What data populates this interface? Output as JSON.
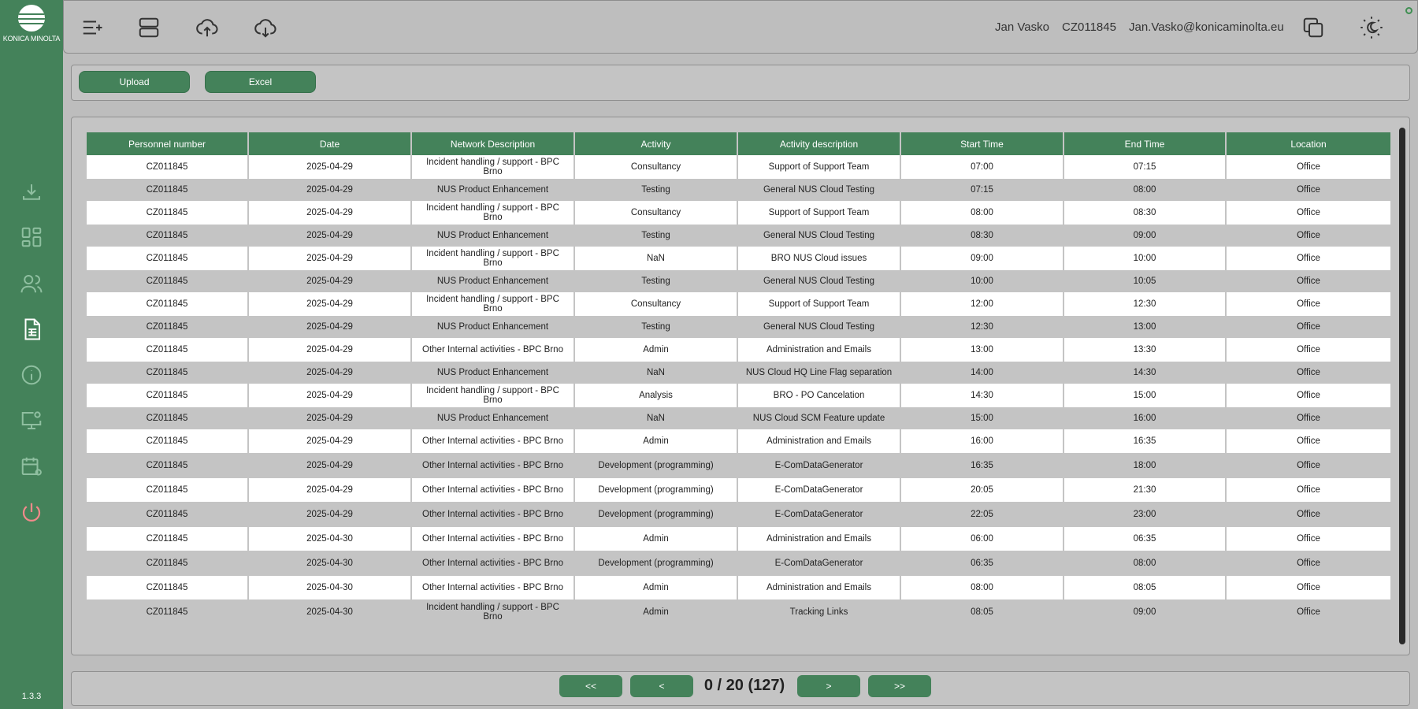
{
  "brand": {
    "logo_text": "KONICA MINOLTA",
    "accent": "#44825a"
  },
  "sidebar": {
    "version": "1.3.3",
    "items": [
      {
        "icon": "download-icon"
      },
      {
        "icon": "dashboard-icon"
      },
      {
        "icon": "users-icon"
      },
      {
        "icon": "report-icon",
        "active": true
      },
      {
        "icon": "info-icon"
      },
      {
        "icon": "monitor-settings-icon"
      },
      {
        "icon": "calendar-settings-icon"
      },
      {
        "icon": "power-icon"
      }
    ]
  },
  "topbar": {
    "user_name": "Jan Vasko",
    "user_id": "CZ011845",
    "user_email": "Jan.Vasko@konicaminolta.eu"
  },
  "toolbar": {
    "upload_label": "Upload",
    "excel_label": "Excel"
  },
  "table": {
    "columns": [
      "Personnel number",
      "Date",
      "Network Description",
      "Activity",
      "Activity description",
      "Start Time",
      "End Time",
      "Location"
    ],
    "rows": [
      [
        "CZ011845",
        "2025-04-29",
        "Incident handling / support - BPC Brno",
        "Consultancy",
        "Support of Support Team",
        "07:00",
        "07:15",
        "Office"
      ],
      [
        "CZ011845",
        "2025-04-29",
        "NUS Product  Enhancement",
        "Testing",
        "General NUS Cloud Testing",
        "07:15",
        "08:00",
        "Office"
      ],
      [
        "CZ011845",
        "2025-04-29",
        "Incident handling / support - BPC Brno",
        "Consultancy",
        "Support of Support Team",
        "08:00",
        "08:30",
        "Office"
      ],
      [
        "CZ011845",
        "2025-04-29",
        "NUS Product  Enhancement",
        "Testing",
        "General NUS Cloud Testing",
        "08:30",
        "09:00",
        "Office"
      ],
      [
        "CZ011845",
        "2025-04-29",
        "Incident handling / support - BPC Brno",
        "NaN",
        "BRO NUS Cloud issues",
        "09:00",
        "10:00",
        "Office"
      ],
      [
        "CZ011845",
        "2025-04-29",
        "NUS Product  Enhancement",
        "Testing",
        "General NUS Cloud Testing",
        "10:00",
        "10:05",
        "Office"
      ],
      [
        "CZ011845",
        "2025-04-29",
        "Incident handling / support - BPC Brno",
        "Consultancy",
        "Support of Support Team",
        "12:00",
        "12:30",
        "Office"
      ],
      [
        "CZ011845",
        "2025-04-29",
        "NUS Product  Enhancement",
        "Testing",
        "General NUS Cloud Testing",
        "12:30",
        "13:00",
        "Office"
      ],
      [
        "CZ011845",
        "2025-04-29",
        "Other Internal activities - BPC Brno",
        "Admin",
        "Administration and Emails",
        "13:00",
        "13:30",
        "Office"
      ],
      [
        "CZ011845",
        "2025-04-29",
        "NUS Product  Enhancement",
        "NaN",
        "NUS Cloud HQ Line Flag separation",
        "14:00",
        "14:30",
        "Office"
      ],
      [
        "CZ011845",
        "2025-04-29",
        "Incident handling / support - BPC Brno",
        "Analysis",
        "BRO - PO Cancelation",
        "14:30",
        "15:00",
        "Office"
      ],
      [
        "CZ011845",
        "2025-04-29",
        "NUS Product  Enhancement",
        "NaN",
        "NUS Cloud SCM Feature update",
        "15:00",
        "16:00",
        "Office"
      ],
      [
        "CZ011845",
        "2025-04-29",
        "Other Internal activities - BPC Brno",
        "Admin",
        "Administration and Emails",
        "16:00",
        "16:35",
        "Office"
      ],
      [
        "CZ011845",
        "2025-04-29",
        "Other Internal activities - BPC Brno",
        "Development (programming)",
        "E-ComDataGenerator",
        "16:35",
        "18:00",
        "Office"
      ],
      [
        "CZ011845",
        "2025-04-29",
        "Other Internal activities - BPC Brno",
        "Development (programming)",
        "E-ComDataGenerator",
        "20:05",
        "21:30",
        "Office"
      ],
      [
        "CZ011845",
        "2025-04-29",
        "Other Internal activities - BPC Brno",
        "Development (programming)",
        "E-ComDataGenerator",
        "22:05",
        "23:00",
        "Office"
      ],
      [
        "CZ011845",
        "2025-04-30",
        "Other Internal activities - BPC Brno",
        "Admin",
        "Administration and Emails",
        "06:00",
        "06:35",
        "Office"
      ],
      [
        "CZ011845",
        "2025-04-30",
        "Other Internal activities - BPC Brno",
        "Development (programming)",
        "E-ComDataGenerator",
        "06:35",
        "08:00",
        "Office"
      ],
      [
        "CZ011845",
        "2025-04-30",
        "Other Internal activities - BPC Brno",
        "Admin",
        "Administration and Emails",
        "08:00",
        "08:05",
        "Office"
      ],
      [
        "CZ011845",
        "2025-04-30",
        "Incident handling / support - BPC Brno",
        "Admin",
        "Tracking Links",
        "08:05",
        "09:00",
        "Office"
      ]
    ]
  },
  "pagination": {
    "first_label": "<<",
    "prev_label": "<",
    "status": "0 / 20 (127)",
    "next_label": ">",
    "last_label": ">>"
  }
}
